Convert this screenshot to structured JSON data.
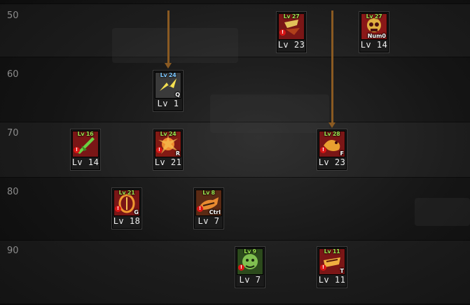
{
  "rows": [
    "50",
    "60",
    "70",
    "80",
    "90"
  ],
  "skills": [
    {
      "row": "50",
      "name": "red-flame-skill",
      "req": "Lv 27",
      "level": "Lv 23",
      "key": "",
      "bg": "#7a1616",
      "glyph": "#e2c25a"
    },
    {
      "row": "50",
      "name": "skull-skill",
      "req": "Lv 27",
      "level": "Lv 14",
      "key": "Num0",
      "bg": "#8a1818",
      "glyph": "#e0b040"
    },
    {
      "row": "60",
      "name": "yellow-slash-skill",
      "req": "Lv 24",
      "level": "Lv 1",
      "key": "Q",
      "bg": "#3a3a3a",
      "glyph": "#f5e050"
    },
    {
      "row": "70",
      "name": "green-spear-skill",
      "req": "Lv 16",
      "level": "Lv 14",
      "key": "",
      "bg": "#7a1616",
      "glyph": "#6ad040"
    },
    {
      "row": "70",
      "name": "fire-burst-skill",
      "req": "Lv 24",
      "level": "Lv 21",
      "key": "R",
      "bg": "#821a14",
      "glyph": "#f08a30"
    },
    {
      "row": "70",
      "name": "golden-dragon-skill",
      "req": "Lv 28",
      "level": "Lv 23",
      "key": "F",
      "bg": "#7a1616",
      "glyph": "#e8a030"
    },
    {
      "row": "80",
      "name": "flame-shield-skill",
      "req": "Lv 21",
      "level": "Lv 18",
      "key": "G",
      "bg": "#7a1616",
      "glyph": "#f09a30"
    },
    {
      "row": "80",
      "name": "tiger-charge-skill",
      "req": "Lv 8",
      "level": "Lv 7",
      "key": "Ctrl",
      "bg": "#5a2a14",
      "glyph": "#e88a30"
    },
    {
      "row": "90",
      "name": "green-beast-skill",
      "req": "Lv 9",
      "level": "Lv 7",
      "key": "",
      "bg": "#2c4a1c",
      "glyph": "#80c050"
    },
    {
      "row": "90",
      "name": "golden-roar-skill",
      "req": "Lv 11",
      "level": "Lv 11",
      "key": "T",
      "bg": "#7a1616",
      "glyph": "#f0b040"
    }
  ]
}
